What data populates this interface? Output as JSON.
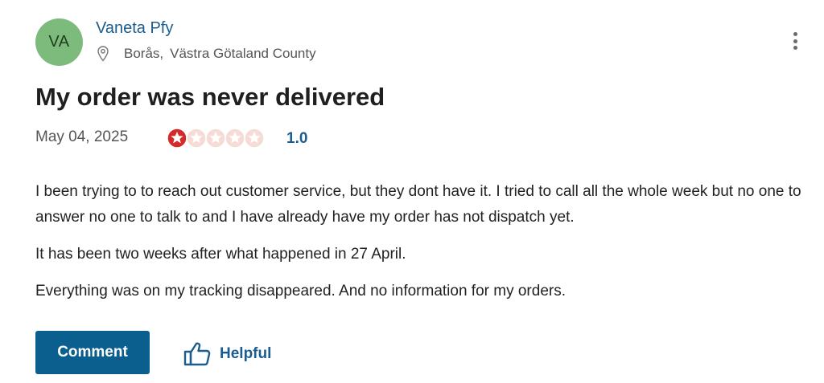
{
  "review": {
    "author": {
      "initials": "VA",
      "name": "Vaneta Pfy",
      "city": "Borås,",
      "region": "Västra Götaland County"
    },
    "title": "My order was never delivered",
    "date": "May 04, 2025",
    "rating": {
      "value": 1,
      "max": 5,
      "label": "1.0",
      "filled_color": "#d42a2a",
      "empty_color": "#f6dcd6"
    },
    "body": [
      "I been trying to to reach out customer service, but they dont have it. I tried to call all the whole week but no one to answer no one to talk to and I have already have my order has not dispatch yet.",
      "It has been two weeks after what happened in 27 April.",
      "Everything was on my tracking disappeared. And no information for my orders."
    ]
  },
  "actions": {
    "comment_label": "Comment",
    "helpful_label": "Helpful"
  },
  "icons": {
    "location": "map-pin-icon",
    "menu": "more-vertical-icon",
    "helpful": "thumbs-up-icon",
    "star": "star-icon"
  },
  "colors": {
    "accent": "#1c5d8f",
    "button": "#0b5f8e",
    "avatar": "#7dbb7d"
  }
}
